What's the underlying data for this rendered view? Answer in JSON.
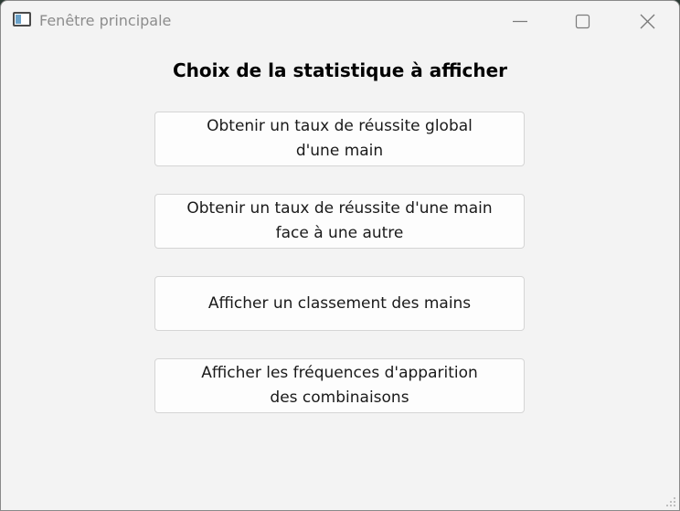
{
  "window": {
    "title": "Fenêtre principale",
    "icon": "application-window-icon",
    "controls": [
      "minimize-icon",
      "maximize-icon",
      "close-icon"
    ]
  },
  "main": {
    "heading": "Choix de la statistique à afficher",
    "buttons": [
      {
        "label": "Obtenir un taux de réussite global\nd'une main"
      },
      {
        "label": "Obtenir un taux de réussite d'une main\nface à une autre"
      },
      {
        "label": "Afficher un classement des mains"
      },
      {
        "label": "Afficher les fréquences d'apparition\ndes combinaisons"
      }
    ]
  }
}
